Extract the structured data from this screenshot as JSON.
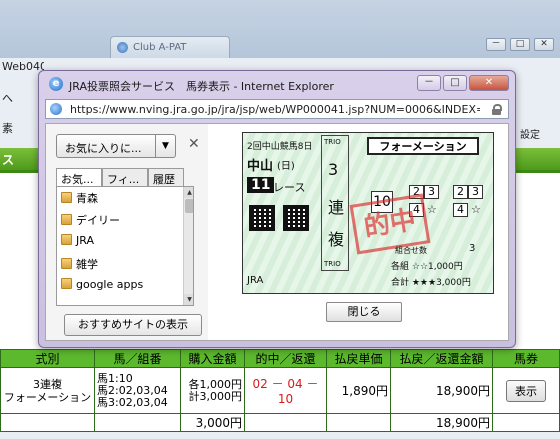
{
  "background_browser": {
    "tab_label": "Club A-PAT",
    "address_stub": "Web040",
    "left_strip": [
      "へ",
      "素"
    ],
    "right_strip": [
      "設定"
    ],
    "menu_band_label": "ス",
    "window_buttons": [
      "－",
      "□",
      "✕"
    ]
  },
  "ie_window": {
    "title": "JRA投票照会サービス　馬券表示 - Internet Explorer",
    "url": "https://www.nving.jra.go.jp/jra/jsp/web/WP000041.jsp?NUM=0006&INDEX=I",
    "controls": {
      "minimize": "－",
      "maximize": "□",
      "close": "✕"
    }
  },
  "favorites": {
    "button_label": "お気に入りに...",
    "dropdown_symbol": "▼",
    "close_symbol": "✕",
    "tabs": [
      "お気...",
      "フィ...",
      "履歴"
    ],
    "items": [
      "青森",
      "デイリー",
      "JRA",
      "雑学",
      "google apps"
    ],
    "suggest_button": "おすすめサイトの表示"
  },
  "ticket": {
    "meeting": "2回中山競馬8日",
    "venue": "中山",
    "day": "(日)",
    "race_number": "11",
    "race_suffix": "レース",
    "trio_top": "TRIO",
    "trio_bottom": "TRIO",
    "bet_type_vertical": [
      "3",
      "連",
      "複"
    ],
    "formation_label": "フォーメーション",
    "first_leg": "10",
    "second_leg": [
      "2",
      "3",
      "4"
    ],
    "third_leg": [
      "2",
      "3",
      "4"
    ],
    "stamp_text": "的中",
    "combos_label": "組合せ数",
    "combos_value": "3",
    "each_label": "各組 ☆☆1,000円",
    "total_label": "合計 ★★★3,000円",
    "jra_label": "JRA",
    "close_button": "閉じる"
  },
  "result_table": {
    "headers": [
      "式別",
      "馬／組番",
      "購入金額",
      "的中／返還",
      "払戻単価",
      "払戻／返還金額",
      "馬券"
    ],
    "row": {
      "type": "3連複\nフォーメーション",
      "combo_lines": [
        "馬1:10",
        "馬2:02,03,04",
        "馬3:02,03,04"
      ],
      "amount_lines": [
        "各1,000円",
        "計3,000円"
      ],
      "hit": "02 － 04 － 10",
      "unit_payout": "1,890円",
      "payout": "18,900円",
      "button": "表示"
    },
    "total_row": {
      "amount": "3,000円",
      "payout": "18,900円"
    }
  }
}
